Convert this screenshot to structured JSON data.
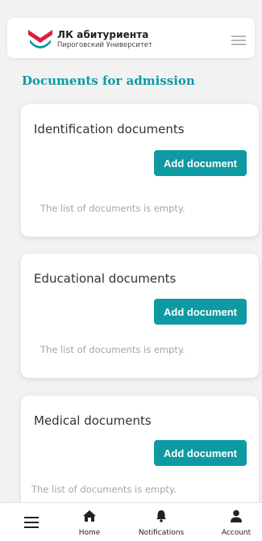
{
  "header": {
    "brand_title": "ЛК абитуриента",
    "brand_subtitle": "Пироговский Университет",
    "logo_icon": "pirogov-logo-icon",
    "menu_icon": "hamburger-menu-icon"
  },
  "page_title": "Documents for admission",
  "sections": [
    {
      "title": "Identification documents",
      "button_label": "Add document",
      "empty_text": "The list of documents is empty."
    },
    {
      "title": "Educational documents",
      "button_label": "Add document",
      "empty_text": "The list of documents is empty."
    },
    {
      "title": "Medical documents",
      "button_label": "Add document",
      "empty_text": "The list of documents is empty."
    }
  ],
  "bottom_nav": {
    "menu_icon": "hamburger-menu-icon",
    "items": [
      {
        "label": "Home",
        "icon": "home-icon"
      },
      {
        "label": "Notifications",
        "icon": "bell-icon"
      },
      {
        "label": "Account",
        "icon": "user-icon"
      }
    ]
  },
  "colors": {
    "accent": "#0d9aa3",
    "logo_red": "#d6223c",
    "logo_teal": "#0d9aa3",
    "background": "#f2f2f2",
    "muted_text": "#a6a6a6"
  }
}
